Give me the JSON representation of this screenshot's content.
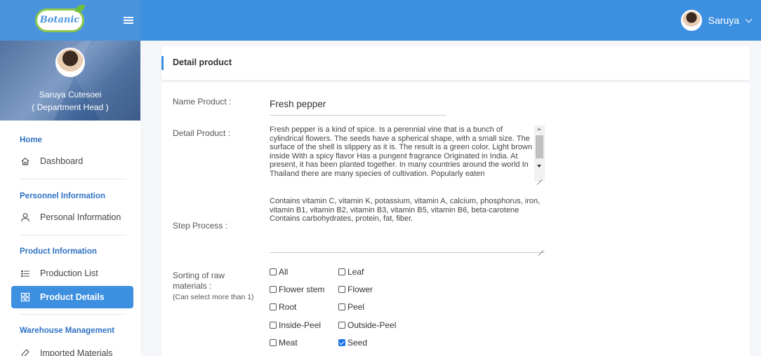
{
  "app": {
    "logo_text": "Botanic",
    "user_name": "Saruya"
  },
  "profile": {
    "name": "Saruya Cutesoei",
    "role": "( Department Head )"
  },
  "sidebar": {
    "sections": [
      {
        "title": "Home",
        "items": [
          {
            "label": "Dashboard",
            "icon": "home-icon"
          }
        ]
      },
      {
        "title": "Personnel Information",
        "items": [
          {
            "label": "Personal Information",
            "icon": "user-icon"
          }
        ]
      },
      {
        "title": "Product Information",
        "items": [
          {
            "label": "Production List",
            "icon": "list-icon"
          },
          {
            "label": "Product Details",
            "icon": "grid-icon",
            "active": true
          }
        ]
      },
      {
        "title": "Warehouse Management",
        "items": [
          {
            "label": "Imported Materials",
            "icon": "import-icon"
          }
        ]
      }
    ]
  },
  "page": {
    "title": "Detail product"
  },
  "form": {
    "name_label": "Name Product :",
    "name_value": "Fresh pepper",
    "detail_label": "Detail Product :",
    "detail_value": "Fresh pepper is a kind of spice. Is a perennial vine that is a bunch of cylindrical flowers. The seeds have a spherical shape, with a small size. The surface of the shell is slippery as it is. The result is a green color. Light brown inside With a spicy flavor Has a pungent fragrance Originated in India. At present, it has been planted together. In many countries around the world In Thailand there are many species of cultivation. Popularly eaten",
    "step_label": "Step Process :",
    "step_value": "Contains vitamin C, vitamin K, potassium, vitamin A, calcium, phosphorus, iron, vitamin B1, vitamin B2, vitamin B3, vitamin B5, vitamin B6, beta-carotene Contains carbohydrates, protein, fat, fiber.",
    "sorting_label_1": "Sorting of raw",
    "sorting_label_2": "materials :",
    "sorting_hint": "(Can select more than 1)",
    "options": [
      {
        "label": "All",
        "checked": false
      },
      {
        "label": "Leaf",
        "checked": false
      },
      {
        "label": "Flower stem",
        "checked": false
      },
      {
        "label": "Flower",
        "checked": false
      },
      {
        "label": "Root",
        "checked": false
      },
      {
        "label": "Peel",
        "checked": false
      },
      {
        "label": "Inside-Peel",
        "checked": false
      },
      {
        "label": "Outside-Peel",
        "checked": false
      },
      {
        "label": "Meat",
        "checked": false
      },
      {
        "label": "Seed",
        "checked": true
      }
    ]
  },
  "colors": {
    "primary": "#3d8fe0",
    "checkbox_checked": "#1a73e8"
  }
}
